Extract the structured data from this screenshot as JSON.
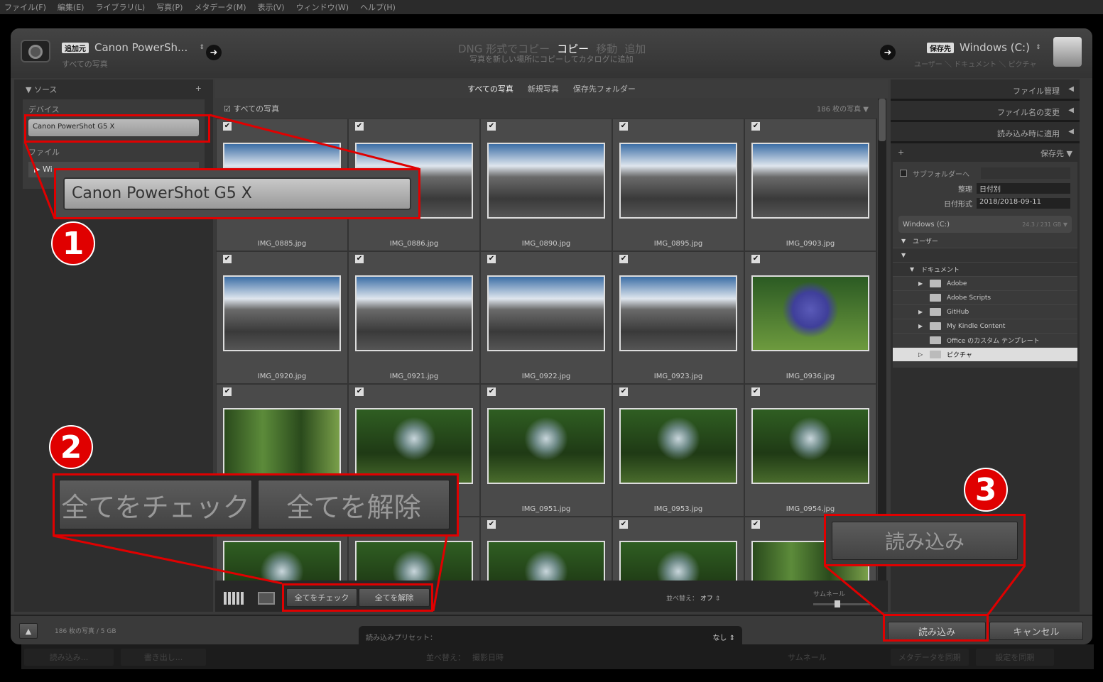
{
  "menu": [
    "ファイル(F)",
    "編集(E)",
    "ライブラリ(L)",
    "写真(P)",
    "メタデータ(M)",
    "表示(V)",
    "ウィンドウ(W)",
    "ヘルプ(H)"
  ],
  "source": {
    "tag": "追加元",
    "name": "Canon PowerSh...",
    "sub": "すべての写真"
  },
  "modes": {
    "dng": "DNG 形式でコピー",
    "copy": "コピー",
    "move": "移動",
    "add": "追加",
    "desc": "写真を新しい場所にコピーしてカタログに追加"
  },
  "dest": {
    "tag": "保存先",
    "name": "Windows (C:)",
    "path": "ユーザー ＼ ドキュメント ＼ ピクチャ"
  },
  "left": {
    "title": "ソース",
    "devices": "デバイス",
    "device": "Canon PowerShot G5 X",
    "files": "ファイル",
    "drive": "Wi"
  },
  "tabs": [
    "すべての写真",
    "新規写真",
    "保存先フォルダー"
  ],
  "grid": {
    "header": "すべての写真",
    "count": "186 枚の写真",
    "rows": [
      [
        {
          "f": "IMG_0885.jpg",
          "t": "m"
        },
        {
          "f": "IMG_0886.jpg",
          "t": "m"
        },
        {
          "f": "IMG_0890.jpg",
          "t": "m"
        },
        {
          "f": "IMG_0895.jpg",
          "t": "m"
        },
        {
          "f": "IMG_0903.jpg",
          "t": "m"
        }
      ],
      [
        {
          "f": "IMG_0920.jpg",
          "t": "m"
        },
        {
          "f": "IMG_0921.jpg",
          "t": "m"
        },
        {
          "f": "IMG_0922.jpg",
          "t": "m"
        },
        {
          "f": "IMG_0923.jpg",
          "t": "m"
        },
        {
          "f": "IMG_0936.jpg",
          "t": "fl"
        }
      ],
      [
        {
          "f": "",
          "t": "f"
        },
        {
          "f": "",
          "t": "g"
        },
        {
          "f": "IMG_0951.jpg",
          "t": "g"
        },
        {
          "f": "IMG_0953.jpg",
          "t": "g"
        },
        {
          "f": "IMG_0954.jpg",
          "t": "g"
        }
      ],
      [
        {
          "f": "",
          "t": "g"
        },
        {
          "f": "",
          "t": "g"
        },
        {
          "f": "",
          "t": "g"
        },
        {
          "f": "",
          "t": "g"
        },
        {
          "f": "",
          "t": "f"
        }
      ]
    ]
  },
  "toolbar": {
    "check_all": "全てをチェック",
    "uncheck_all": "全てを解除",
    "sort_label": "並べ替え：",
    "sort_value": "オフ",
    "thumb_label": "サムネール"
  },
  "right": {
    "file_handling": "ファイル管理",
    "rename": "ファイル名の変更",
    "apply": "読み込み時に適用",
    "destination": "保存先",
    "subfolder": "サブフォルダーへ",
    "organize_label": "整理",
    "organize": "日付別",
    "date_label": "日付形式",
    "date": "2018/2018-09-11",
    "volume": "Windows (C:)",
    "space": "24.3 / 231 GB",
    "tree": [
      {
        "label": "ユーザー",
        "lvl": 0,
        "arrow": "▼"
      },
      {
        "label": "",
        "lvl": 0,
        "arrow": "▼"
      },
      {
        "label": "ドキュメント",
        "lvl": 1,
        "arrow": "▼"
      },
      {
        "label": "Adobe",
        "lvl": 2,
        "arrow": "▶",
        "folder": true
      },
      {
        "label": "Adobe Scripts",
        "lvl": 2,
        "arrow": "",
        "folder": true
      },
      {
        "label": "GitHub",
        "lvl": 2,
        "arrow": "▶",
        "folder": true
      },
      {
        "label": "My Kindle Content",
        "lvl": 2,
        "arrow": "▶",
        "folder": true
      },
      {
        "label": "Office のカスタム テンプレート",
        "lvl": 2,
        "arrow": "",
        "folder": true
      },
      {
        "label": "ピクチャ",
        "lvl": 2,
        "arrow": "▷",
        "folder": true,
        "selected": true
      }
    ]
  },
  "footer": {
    "summary": "186 枚の写真 / 5 GB",
    "preset_label": "読み込みプリセット：",
    "preset": "なし",
    "import": "読み込み",
    "cancel": "キャンセル"
  },
  "background": {
    "import": "読み込み...",
    "export": "書き出し...",
    "sort": "並べ替え：",
    "sort_value": "撮影日時",
    "thumb": "サムネール",
    "sync_meta": "メタデータを同期",
    "sync_settings": "設定を同期"
  },
  "callouts": [
    "1",
    "2",
    "3"
  ],
  "colors": {
    "annotation": "#e00000"
  }
}
